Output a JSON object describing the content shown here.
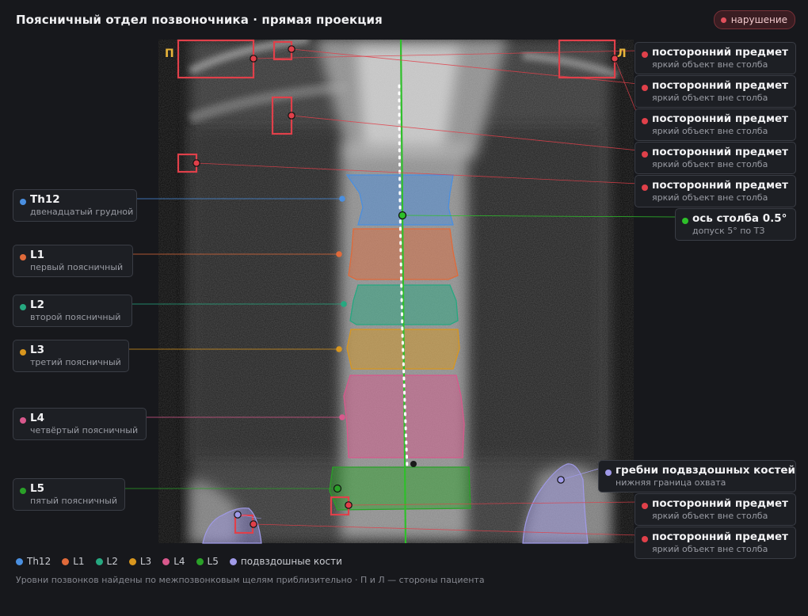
{
  "title": "Поясничный отдел позвоночника · прямая проекция",
  "badge": "нарушение",
  "side_left": "П",
  "side_right": "Л",
  "colors": {
    "Th12": "#4a8fe0",
    "L1": "#e06a3a",
    "L2": "#26a880",
    "L3": "#d8961e",
    "L4": "#d8588c",
    "L5": "#2aa028",
    "iliac": "#a09ae8",
    "foreign": "#e0404a",
    "axis": "#2ec02a"
  },
  "vertebrae": [
    {
      "key": "Th12",
      "title": "Th12",
      "sub": "двенадцатый грудной"
    },
    {
      "key": "L1",
      "title": "L1",
      "sub": "первый поясничный"
    },
    {
      "key": "L2",
      "title": "L2",
      "sub": "второй поясничный"
    },
    {
      "key": "L3",
      "title": "L3",
      "sub": "третий поясничный"
    },
    {
      "key": "L4",
      "title": "L4",
      "sub": "четвёртый поясничный"
    },
    {
      "key": "L5",
      "title": "L5",
      "sub": "пятый поясничный"
    }
  ],
  "foreign_objects": [
    {
      "title": "посторонний предмет",
      "sub": "яркий объект вне столба"
    },
    {
      "title": "посторонний предмет",
      "sub": "яркий объект вне столба"
    },
    {
      "title": "посторонний предмет",
      "sub": "яркий объект вне столба"
    },
    {
      "title": "посторонний предмет",
      "sub": "яркий объект вне столба"
    },
    {
      "title": "посторонний предмет",
      "sub": "яркий объект вне столба"
    },
    {
      "title": "посторонний предмет",
      "sub": "яркий объект вне столба"
    },
    {
      "title": "посторонний предмет",
      "sub": "яркий объект вне столба"
    }
  ],
  "axis": {
    "title": "ось столба 0.5°",
    "sub": "допуск 5° по ТЗ"
  },
  "iliac": {
    "title": "гребни подвздошных костей",
    "sub": "нижняя граница охвата"
  },
  "legend": [
    {
      "key": "Th12",
      "label": "Th12"
    },
    {
      "key": "L1",
      "label": "L1"
    },
    {
      "key": "L2",
      "label": "L2"
    },
    {
      "key": "L3",
      "label": "L3"
    },
    {
      "key": "L4",
      "label": "L4"
    },
    {
      "key": "L5",
      "label": "L5"
    },
    {
      "key": "iliac",
      "label": "подвздошные кости"
    }
  ],
  "footnote": "Уровни позвонков найдены по межпозвонковым щелям приблизительно · П и Л — стороны пациента"
}
